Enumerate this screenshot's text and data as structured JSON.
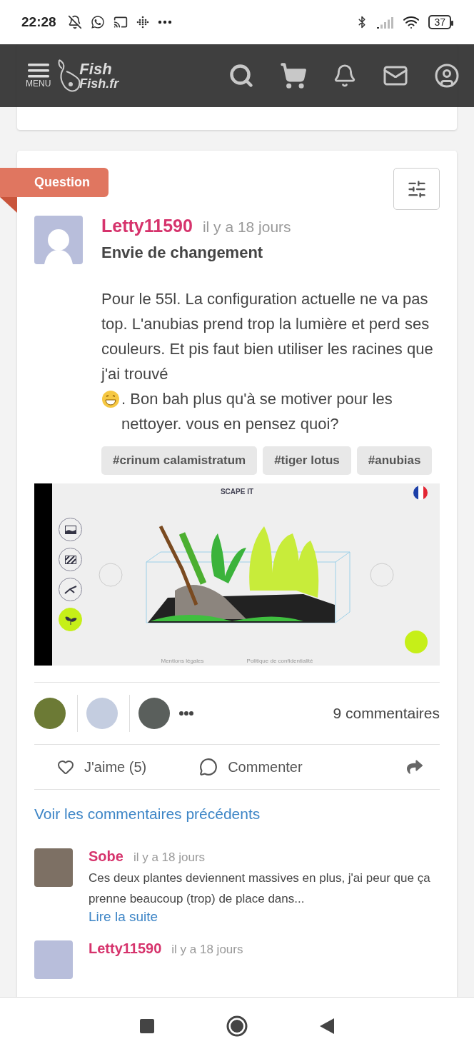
{
  "status_bar": {
    "time": "22:28",
    "battery": "37"
  },
  "header": {
    "menu_label": "MENU",
    "logo": [
      "Fish",
      "Fish.fr"
    ]
  },
  "post": {
    "badge": "Question",
    "author": "Letty11590",
    "time": "il y a 18 jours",
    "title": "Envie de changement",
    "body_before": "Pour le 55l. La configuration actuelle ne va pas top. L'anubias prend trop la lumière et perd ses couleurs. Et pis faut bien utiliser les racines que j'ai trouvé",
    "body_after": ". Bon bah plus qu'à se motiver pour les nettoyer. vous en pensez quoi?",
    "tags": [
      "#crinum calamistratum",
      "#tiger lotus",
      "#anubias"
    ],
    "screenshot": {
      "title": "SCAPE IT",
      "tools": [
        {
          "kind": "background",
          "selected": false
        },
        {
          "kind": "substrate",
          "selected": false
        },
        {
          "kind": "wood",
          "selected": false
        },
        {
          "kind": "plant",
          "selected": true
        }
      ],
      "footer": [
        "Mentions légales",
        "Politique de confidentialité"
      ]
    },
    "comment_count": "9 commentaires",
    "actions": [
      "J'aime (5)",
      "Commenter"
    ],
    "previous_link": "Voir les commentaires précédents",
    "comments": [
      {
        "author": "Sobe",
        "time": "il y a 18 jours",
        "text": "Ces deux plantes deviennent massives en plus, j'ai peur que ça prenne beaucoup (trop) de place dans...",
        "more": "Lire la suite"
      },
      {
        "author": "Letty11590",
        "time": "il y a 18 jours"
      }
    ]
  }
}
